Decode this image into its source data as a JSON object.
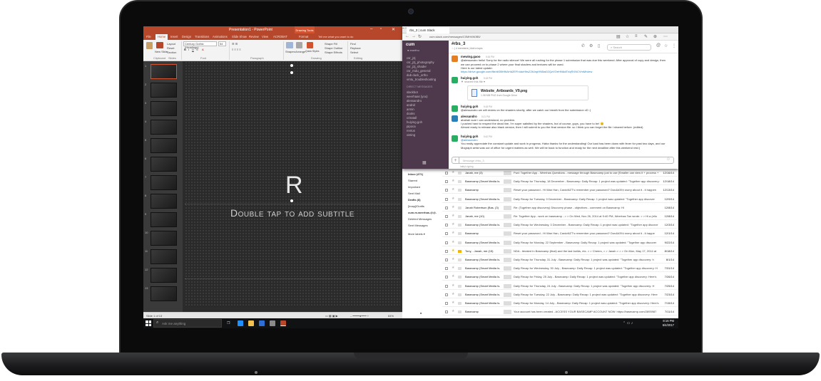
{
  "powerpoint": {
    "title": "Presentation1 - PowerPoint",
    "context_tab": "Drawing Tools",
    "tabs": [
      "File",
      "Home",
      "Insert",
      "Design",
      "Transitions",
      "Animations",
      "Slide Show",
      "Review",
      "View",
      "ACROBAT",
      "Format"
    ],
    "tell_me": "Tell me what you want to do",
    "ribbon": {
      "font_name": "Century Gothic (Headings)",
      "font_size": "54",
      "new_slide": "New Slide",
      "layout": "Layout",
      "reset": "Reset",
      "section": "Section",
      "shapes": "Shapes",
      "arrange": "Arrange",
      "quick_styles": "Quick Styles",
      "shape_fill": "Shape Fill",
      "shape_outline": "Shape Outline",
      "shape_effects": "Shape Effects",
      "find": "Find",
      "replace": "Replace",
      "select": "Select",
      "groups": [
        "Clipboard",
        "Slides",
        "Font",
        "Paragraph",
        "Drawing",
        "Editing"
      ]
    },
    "slide_numbers": [
      "1",
      "2",
      "3",
      "4",
      "5",
      "6",
      "7",
      "8",
      "9",
      "10",
      "11",
      "12",
      "13"
    ],
    "slide": {
      "title": "R",
      "subtitle": "Double tap to add subtitle"
    },
    "status": {
      "slide_count": "Slide 1 of 13",
      "zoom": "84%"
    }
  },
  "slack": {
    "browser_tab": "rbs_3 | cum Slack",
    "url": "cum.slack.com/messages/C0MH4N0B5/",
    "team": "cum",
    "user": "● eserthu",
    "channels": [
      "csr_j2j",
      "csr_j2j_photography",
      "csr_j2j_shader",
      "csr_rndu_general",
      "dub duck_ortho",
      "vmtu_troubleshooting"
    ],
    "dm_header": "DIRECT MESSAGES",
    "dms": [
      "slackbot",
      "weerhaas (you)",
      "alessandro",
      "andrid",
      "armin",
      "dooks",
      "crisstall",
      "huiying.goh",
      "pipoca",
      "rentus",
      "xisting"
    ],
    "channel": {
      "name": "#rbs_3",
      "meta": "☆ | 4 members | Add a topic",
      "search_placeholder": "Search"
    },
    "messages": [
      {
        "name": "mewing.gaoo",
        "time": "5:16 PM",
        "text": "@alessandro hello! Sorry for the radio silence! We were all rushing for the phase 1 submission that was due this weekend. After approval of copy and design, then we can proceed on to phase 2 where your final shaders and textures will be used.",
        "text2": "Here is our latest update:",
        "link": "https://drive.google.com/file/d/0BH9tAHd2EFh4dcHhsZ2tUnpHN5ai02QzVOeHN6cEVqRXNCVmM/view"
      },
      {
        "name": "huiying.goh",
        "time": "5:18 PM",
        "shared": "▼ shared this file ▾",
        "file_name": "Website_Artboards_V9.png",
        "file_meta": "1.08 MB PNG from Google Drive"
      },
      {
        "name": "huiying.goh",
        "time": "5:18 PM",
        "text": "@alessandro we will review on the shaders shortly, after we catch our breath from the submission xD :)"
      },
      {
        "name": "alessandro",
        "time": "5:21 PM",
        "text": "ahahah sure i can understand, no problem.",
        "text2": "I pushed hard to respect the dead line, I'm super satisfied by the shaders, but of course, guys, you have to be! 😊",
        "text3": "Almost ready to release also black version, then I will submit to you the final version file. so I think you can forget the file I shared before. (edited)"
      },
      {
        "name": "huiying.goh",
        "time": "5:42 PM",
        "text": "@alessandro",
        "text2": "You really appreciate the constant update and work in progress. Haha thanks for the understanding! Our load has been down with fever for past two days, and our Mograph artist was out of office for urgent matters as well. We will be back to function and ready for the next deadline after this weekend rest:)"
      }
    ],
    "input_placeholder": "Message #rbs_3",
    "typing": "hatty's typing"
  },
  "gmail": {
    "nav": [
      "Inbox (471)",
      "Starred",
      "Important",
      "Sent Mail",
      "Drafts (8)",
      "[Imap]/Drafts",
      "cum.m.weerhas.@@.",
      "Deleted Messages",
      "Sent Messages",
      "More labels ▾"
    ],
    "rows": [
      {
        "sender": "Janah, me (3)",
        "subject": "Fwd: Together App - Weerhas Questions - message through Basecamp just to use [Smaller can view it + process + ",
        "date": "12/16/14",
        "star": false,
        "imp": false
      },
      {
        "sender": "Basecamp (Smart Media Is.",
        "subject": "Daily Recap for Thursday, 18 December - Basecamp: Daily Recap: 1 project was updated: \"Together app discovery: h",
        "date": "12/18/14",
        "star": false,
        "imp": false
      },
      {
        "sender": "Basecamp",
        "subject": "Reset your password - Hi Wan Han, CardoNZT's remember your password? Don&#39;t worry about it - it happen",
        "date": "12/13/14",
        "star": false,
        "imp": false
      },
      {
        "sender": "Basecamp (Smart Media Is.",
        "subject": "Daily Recap for Tuesday, 9 December - Basecamp: Daily Recap: 1 project was updated: \"Together app discover",
        "date": "12/9/14",
        "star": false,
        "imp": false
      },
      {
        "sender": "Janah Robertson (Bas. (3)",
        "subject": "Re: (Together app discovery) Discovery phase - objectives - comment on Basecamp: Hi",
        "date": "12/8/14",
        "star": false,
        "imp": false
      },
      {
        "sender": "Janah, me (10)",
        "subject": "Re: Together App - work on basecamp - > > On Wed, Nov 26, 2014 at 9:40 PM, Weerhas Tan wrote: > > Hi a (ello",
        "date": "12/8/14",
        "star": false,
        "imp": false
      },
      {
        "sender": "Basecamp (Smart Media Is.",
        "subject": "Daily Recap for Wednesday, 3 December - Basecamp: Daily Recap: 1 project was updated: \"Together app discove",
        "date": "12/3/14",
        "star": false,
        "imp": false
      },
      {
        "sender": "Basecamp",
        "subject": "Reset your password - Hi Wan Han, CardoNZT's remember your password? Don&#39;t worry about it - it happe",
        "date": "12/1/14",
        "star": false,
        "imp": false
      },
      {
        "sender": "Basecamp (Smart Media Is.",
        "subject": "Daily Recap for Monday, 22 September - Basecamp: Daily Recap: 1 project was updated: \"Together app discover",
        "date": "9/22/14",
        "star": false,
        "imp": false
      },
      {
        "sender": "Tony, ..Janah, me (15)",
        "subject": "NDA - iterated In Basecamp (final) and the last builds, etc. > > Cheers, > > Janah > > > On Mon, May 17, 2014 at",
        "date": "8/18/14",
        "star": true,
        "imp": true
      },
      {
        "sender": "Basecamp (Smart Media Is.",
        "subject": "Daily Recap for Thursday, 31 July - Basecamp: Daily Recap: 1 project was updated: \"Together app discovery: h",
        "date": "8/1/14",
        "star": false,
        "imp": false
      },
      {
        "sender": "Basecamp (Smart Media Is.",
        "subject": "Daily Recap for Wednesday, 30 July - Basecamp: Daily Recap: 1 project was updated: \"Together app discovery: H",
        "date": "7/31/14",
        "star": false,
        "imp": false
      },
      {
        "sender": "Basecamp (Smart Media Is.",
        "subject": "Daily Recap for Friday, 25 July - Basecamp: Daily Recap: 1 project was updated: \"Together app discovery: Here's",
        "date": "7/26/14",
        "star": false,
        "imp": false
      },
      {
        "sender": "Basecamp (Smart Media Is.",
        "subject": "Daily Recap for Thursday, 24 July - Basecamp: Daily Recap: 1 project was updated: \"Together app discovery: H",
        "date": "7/25/14",
        "star": false,
        "imp": false
      },
      {
        "sender": "Basecamp (Smart Media Is.",
        "subject": "Daily Recap for Tuesday, 22 July - Basecamp: Daily Recap: 1 project was updated: \"Together app discovery: Here",
        "date": "7/23/14",
        "star": false,
        "imp": false
      },
      {
        "sender": "Basecamp (Smart Media Is.",
        "subject": "Daily Recap for Monday, 14 July - Basecamp: Daily Recap: 1 project was updated: \"Together app discovery: Here's",
        "date": "7/15/14",
        "star": false,
        "imp": false
      },
      {
        "sender": "Basecamp",
        "subject": "Your account has been created - ACCESS YOUR BASECAMP ACCOUNT NOW: https://basecamp.com/2893987",
        "date": "7/11/14",
        "star": false,
        "imp": false
      }
    ]
  },
  "taskbar": {
    "search_placeholder": "Ask me anything",
    "time": "8:16 PM",
    "date": "6/4/2017"
  },
  "colors": {
    "powerpoint_accent": "#b7472a",
    "slack_sidebar": "#4d394b",
    "slack_link": "#2a80b9",
    "gmail_star": "#f4b400"
  }
}
